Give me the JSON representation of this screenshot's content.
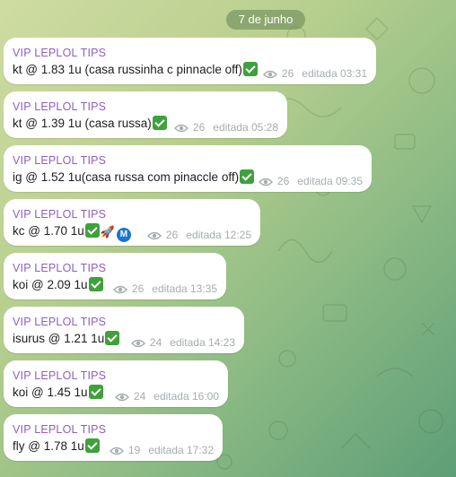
{
  "date_pill": "7 de junho",
  "messages": [
    {
      "sender": "VIP LEPLOL TIPS",
      "text": "kt @ 1.83 1u (casa russinha c pinnacle off)",
      "emoji": [
        "check"
      ],
      "views": "26",
      "edited": "editada 03:31"
    },
    {
      "sender": "VIP LEPLOL TIPS",
      "text": "kt @ 1.39 1u (casa russa)",
      "emoji": [
        "check"
      ],
      "views": "26",
      "edited": "editada 05:28"
    },
    {
      "sender": "VIP LEPLOL TIPS",
      "text": "ig @ 1.52 1u(casa russa com pinaccle off)",
      "emoji": [
        "check"
      ],
      "views": "26",
      "edited": "editada 09:35"
    },
    {
      "sender": "VIP LEPLOL TIPS",
      "text": "kc @ 1.70 1u",
      "emoji": [
        "check",
        "rocket",
        "metro-m"
      ],
      "views": "26",
      "edited": "editada 12:25"
    },
    {
      "sender": "VIP LEPLOL TIPS",
      "text": "koi @ 2.09 1u",
      "emoji": [
        "check"
      ],
      "views": "26",
      "edited": "editada 13:35"
    },
    {
      "sender": "VIP LEPLOL TIPS",
      "text": "isurus @ 1.21 1u",
      "emoji": [
        "check"
      ],
      "views": "24",
      "edited": "editada 14:23"
    },
    {
      "sender": "VIP LEPLOL TIPS",
      "text": "koi @ 1.45 1u",
      "emoji": [
        "check"
      ],
      "views": "24",
      "edited": "editada 16:00"
    },
    {
      "sender": "VIP LEPLOL TIPS",
      "text": "fly @ 1.78 1u",
      "emoji": [
        "check"
      ],
      "views": "19",
      "edited": "editada 17:32"
    }
  ],
  "emoji_glyphs": {
    "rocket": "🚀",
    "metro-m": "M"
  },
  "colors": {
    "sender": "#8e5fc5",
    "meta": "#a6acaf",
    "check": "#3fa13b",
    "metro_badge": "#1976d2"
  }
}
